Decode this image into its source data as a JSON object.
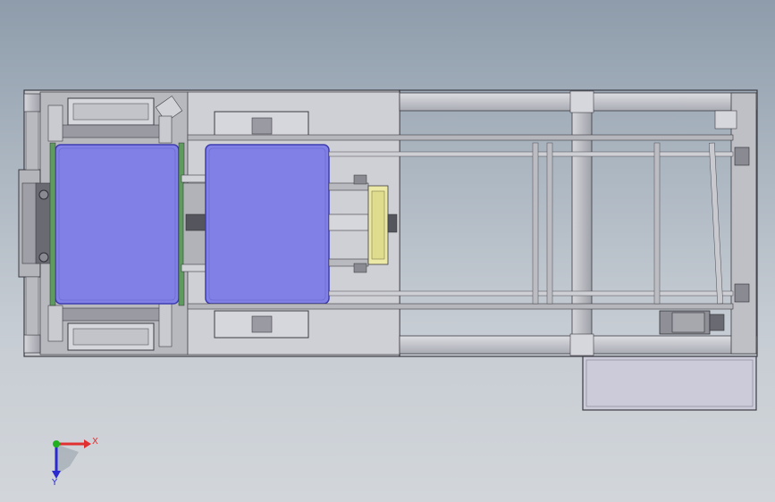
{
  "viewport": {
    "background_top": "#8e9cab",
    "background_bottom": "#d2d6da"
  },
  "colors": {
    "frame_fill": "#c2c3c8",
    "frame_stroke": "#3c3c44",
    "plate_fill": "#d0d0d5",
    "tray_fill": "#8080e6",
    "tray_stroke": "#3d3db0",
    "yellow_part": "#ece9a6",
    "dark_part": "#55565d",
    "box_fill": "#ccccd9"
  },
  "triad": {
    "x_label": "X",
    "y_label": "Y",
    "x_color": "#e03030",
    "y_color": "#2a2ad0",
    "origin_color": "#20b020"
  }
}
